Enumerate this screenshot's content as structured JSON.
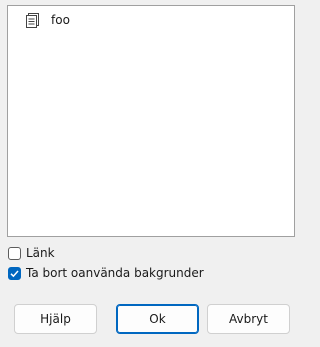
{
  "list": {
    "items": [
      {
        "label": "foo",
        "icon": "document-icon"
      }
    ]
  },
  "options": {
    "link": {
      "label": "Länk",
      "checked": false
    },
    "remove_unused": {
      "label": "Ta bort oanvända bakgrunder",
      "checked": true
    }
  },
  "buttons": {
    "help": "Hjälp",
    "ok": "Ok",
    "cancel": "Avbryt"
  },
  "colors": {
    "accent": "#0067c0",
    "background": "#f0f0f0"
  }
}
